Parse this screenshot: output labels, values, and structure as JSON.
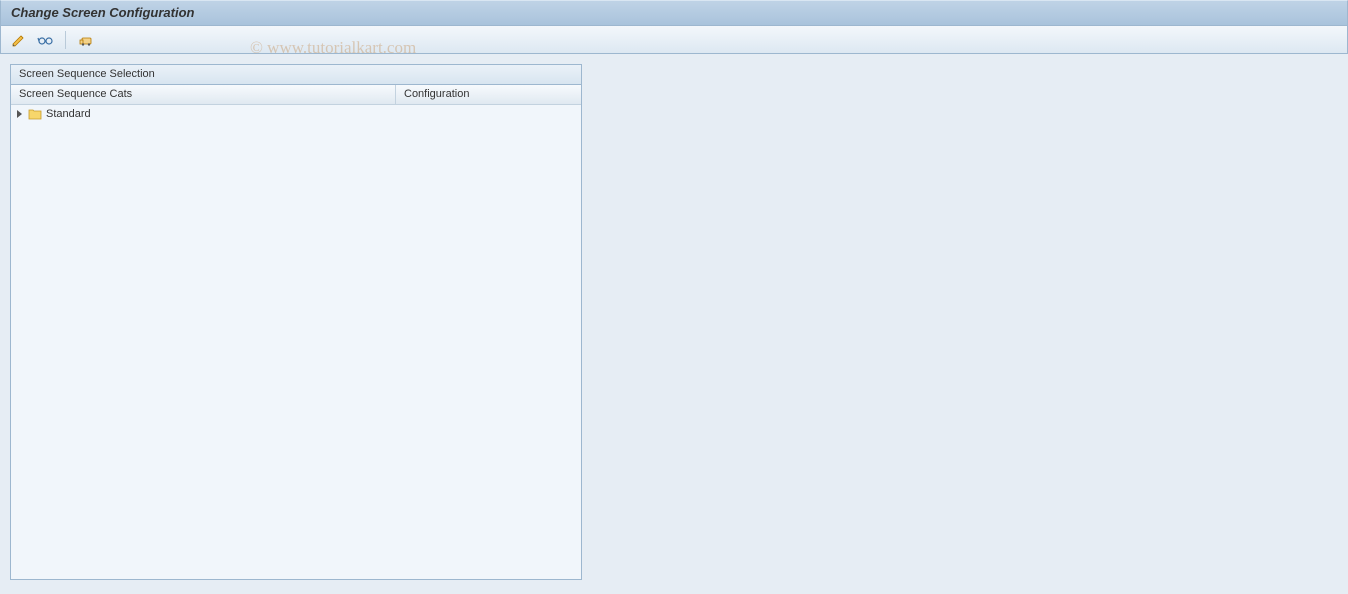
{
  "titlebar": {
    "title": "Change Screen Configuration"
  },
  "toolbar": {
    "btn1_name": "pencil-toggle-icon",
    "btn2_name": "glasses-display-icon",
    "btn3_name": "transport-icon"
  },
  "panel": {
    "title": "Screen Sequence Selection",
    "columns": {
      "col1": "Screen Sequence Cats",
      "col2": "Configuration"
    },
    "rows": [
      {
        "label": "Standard",
        "config": ""
      }
    ]
  },
  "watermark": "© www.tutorialkart.com"
}
